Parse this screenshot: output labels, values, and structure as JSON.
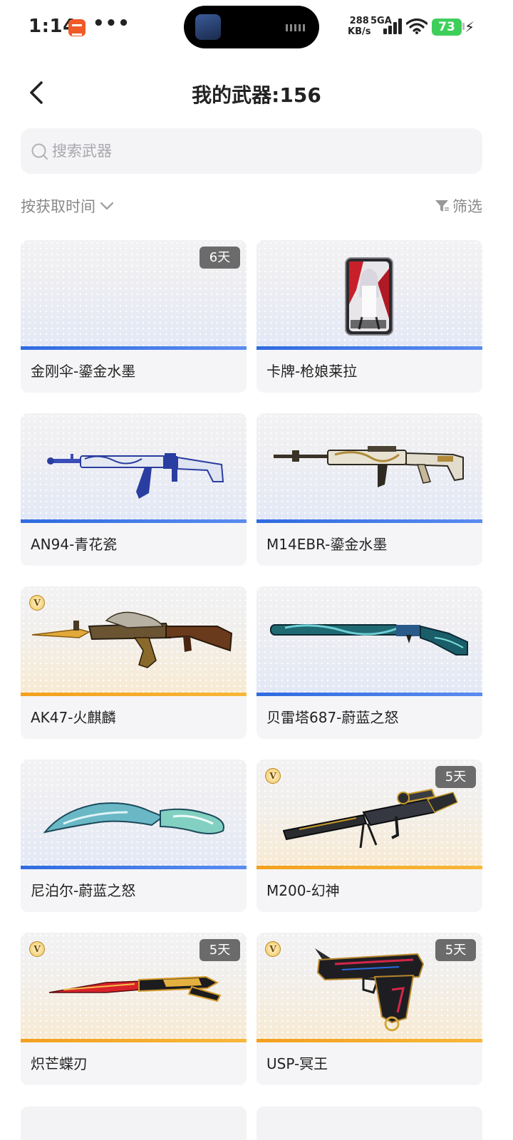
{
  "status_bar": {
    "time": "1:14",
    "dots": "•••",
    "net_speed_value": "288",
    "net_speed_unit": "KB/s",
    "net_type": "5GA",
    "battery": "73"
  },
  "header": {
    "title": "我的武器:156"
  },
  "search": {
    "placeholder": "搜索武器"
  },
  "toolbar": {
    "sort_label": "按获取时间",
    "filter_label": "筛选"
  },
  "weapons": [
    {
      "name": "金刚伞-鎏金水墨",
      "days": "6天",
      "vip": false,
      "tier": "blue",
      "icon": "empty-image"
    },
    {
      "name": "卡牌-枪娘莱拉",
      "days": "",
      "vip": false,
      "tier": "blue",
      "icon": "card-image"
    },
    {
      "name": "AN94-青花瓷",
      "days": "",
      "vip": false,
      "tier": "blue",
      "icon": "rifle-image"
    },
    {
      "name": "M14EBR-鎏金水墨",
      "days": "",
      "vip": false,
      "tier": "blue",
      "icon": "rifle-image"
    },
    {
      "name": "AK47-火麒麟",
      "days": "",
      "vip": true,
      "vip_symbol": "V",
      "tier": "gold",
      "icon": "rifle-image"
    },
    {
      "name": "贝雷塔687-蔚蓝之怒",
      "days": "",
      "vip": false,
      "tier": "blue",
      "icon": "shotgun-image"
    },
    {
      "name": "尼泊尔-蔚蓝之怒",
      "days": "",
      "vip": false,
      "tier": "blue",
      "icon": "knife-image"
    },
    {
      "name": "M200-幻神",
      "days": "5天",
      "vip": true,
      "vip_symbol": "V",
      "tier": "gold",
      "icon": "sniper-image"
    },
    {
      "name": "炽芒蝶刃",
      "days": "5天",
      "vip": true,
      "vip_symbol": "V",
      "tier": "gold",
      "icon": "blade-image"
    },
    {
      "name": "USP-冥王",
      "days": "5天",
      "vip": true,
      "vip_symbol": "V",
      "tier": "gold",
      "icon": "pistol-image"
    }
  ],
  "colors": {
    "blue_tier": "#2f6be0",
    "gold_tier": "#f3a01e",
    "badge_bg": "#6b6b6b",
    "battery": "#3ecf5b"
  }
}
